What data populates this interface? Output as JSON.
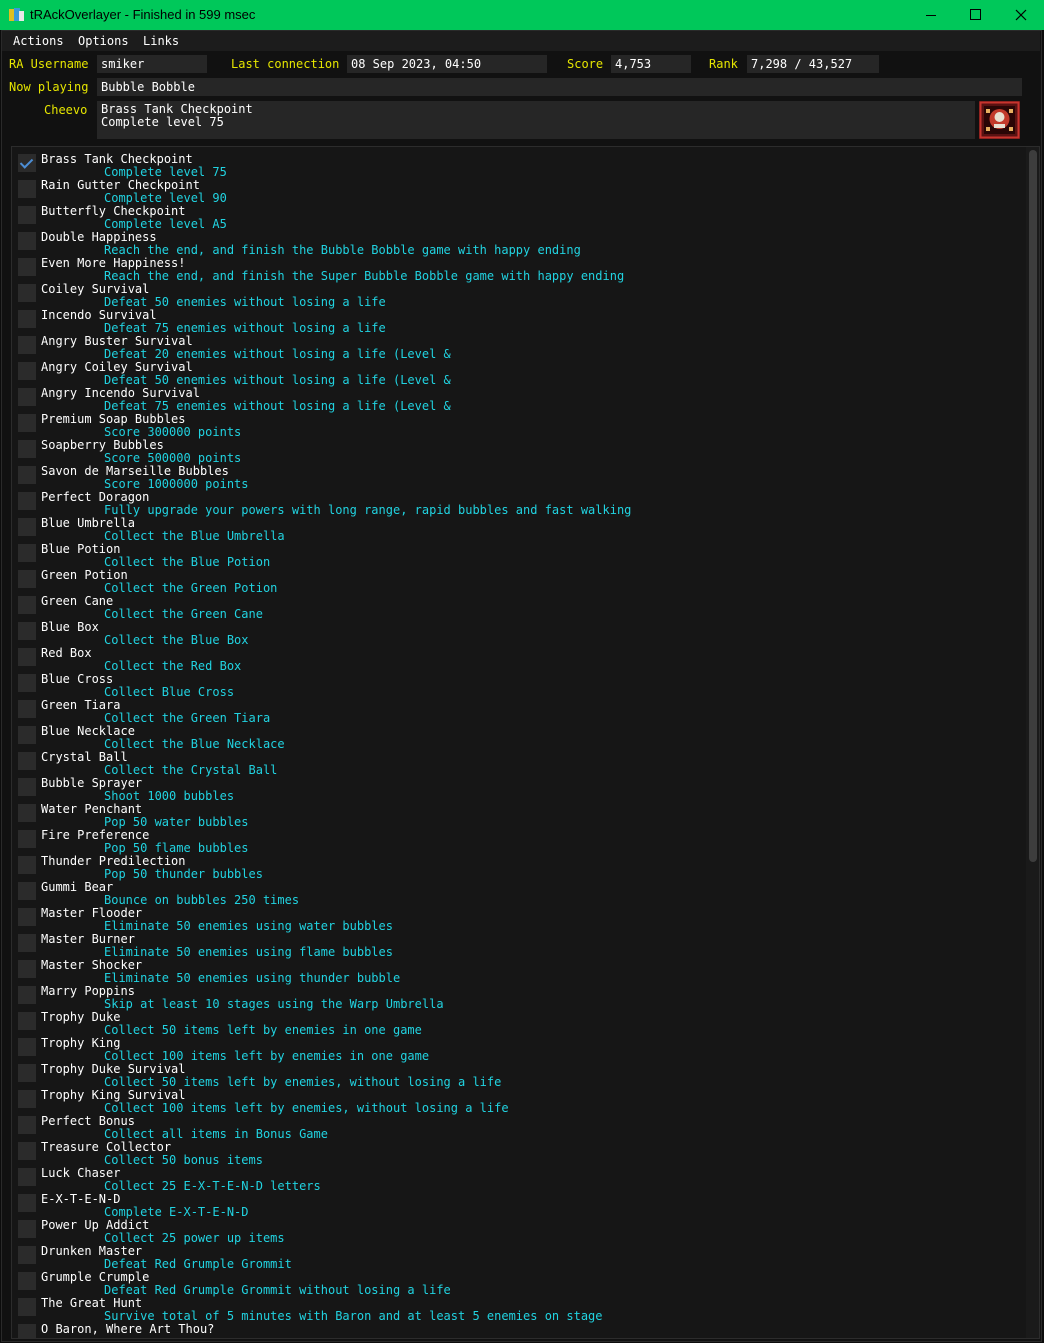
{
  "window": {
    "title": "tRAckOverlayer - Finished in 599 msec",
    "accent_color": "#00c85a",
    "icons": [
      "app-icon",
      "minimize-icon",
      "maximize-icon",
      "close-icon"
    ]
  },
  "menu": [
    "Actions",
    "Options",
    "Links"
  ],
  "header": {
    "username_label": "RA Username",
    "username": "smiker",
    "last_connection_label": "Last connection",
    "last_connection": "08 Sep 2023, 04:50",
    "score_label": "Score",
    "score": "4,753",
    "rank_label": "Rank",
    "rank": "7,298 / 43,527",
    "now_playing_label": "Now playing",
    "now_playing": "Bubble Bobble",
    "cheevo_label": "Cheevo",
    "cheevo_title": "Brass Tank Checkpoint",
    "cheevo_desc": "Complete level 75",
    "label_color": "#e6e600",
    "desc_color": "#21d3e1"
  },
  "achievements": [
    {
      "title": "Brass Tank Checkpoint",
      "desc": "Complete level 75",
      "checked": true
    },
    {
      "title": "Rain Gutter Checkpoint",
      "desc": "Complete level 90",
      "checked": false
    },
    {
      "title": "Butterfly Checkpoint",
      "desc": "Complete level A5",
      "checked": false
    },
    {
      "title": "Double Happiness",
      "desc": "Reach the end, and finish the Bubble Bobble game with happy ending",
      "checked": false
    },
    {
      "title": "Even More Happiness!",
      "desc": "Reach the end, and finish the Super Bubble Bobble game with happy ending",
      "checked": false
    },
    {
      "title": "Coiley Survival",
      "desc": "Defeat 50 enemies without losing a life",
      "checked": false
    },
    {
      "title": "Incendo Survival",
      "desc": "Defeat 75 enemies without losing a life",
      "checked": false
    },
    {
      "title": "Angry Buster Survival",
      "desc": "Defeat 20 enemies without losing a life (Level &",
      "checked": false
    },
    {
      "title": "Angry Coiley Survival",
      "desc": "Defeat 50 enemies without losing a life (Level &",
      "checked": false
    },
    {
      "title": "Angry Incendo Survival",
      "desc": "Defeat 75 enemies without losing a life (Level &",
      "checked": false
    },
    {
      "title": "Premium Soap Bubbles",
      "desc": "Score 300000 points",
      "checked": false
    },
    {
      "title": "Soapberry Bubbles",
      "desc": "Score 500000 points",
      "checked": false
    },
    {
      "title": "Savon de Marseille Bubbles",
      "desc": "Score 1000000 points",
      "checked": false
    },
    {
      "title": "Perfect Doragon",
      "desc": "Fully upgrade your powers with long range, rapid bubbles and fast walking",
      "checked": false
    },
    {
      "title": "Blue Umbrella",
      "desc": "Collect the Blue Umbrella",
      "checked": false
    },
    {
      "title": "Blue Potion",
      "desc": "Collect the Blue Potion",
      "checked": false
    },
    {
      "title": "Green Potion",
      "desc": "Collect the Green Potion",
      "checked": false
    },
    {
      "title": "Green Cane",
      "desc": "Collect the Green Cane",
      "checked": false
    },
    {
      "title": "Blue Box",
      "desc": "Collect the Blue Box",
      "checked": false
    },
    {
      "title": "Red Box",
      "desc": "Collect the Red Box",
      "checked": false
    },
    {
      "title": "Blue Cross",
      "desc": "Collect Blue Cross",
      "checked": false
    },
    {
      "title": "Green Tiara",
      "desc": "Collect the Green Tiara",
      "checked": false
    },
    {
      "title": "Blue Necklace",
      "desc": "Collect the Blue Necklace",
      "checked": false
    },
    {
      "title": "Crystal Ball",
      "desc": "Collect the Crystal Ball",
      "checked": false
    },
    {
      "title": "Bubble Sprayer",
      "desc": "Shoot 1000 bubbles",
      "checked": false
    },
    {
      "title": "Water Penchant",
      "desc": "Pop 50 water bubbles",
      "checked": false
    },
    {
      "title": "Fire Preference",
      "desc": "Pop 50 flame bubbles",
      "checked": false
    },
    {
      "title": "Thunder Predilection",
      "desc": "Pop 50 thunder bubbles",
      "checked": false
    },
    {
      "title": "Gummi Bear",
      "desc": "Bounce on bubbles 250 times",
      "checked": false
    },
    {
      "title": "Master Flooder",
      "desc": "Eliminate 50 enemies using water bubbles",
      "checked": false
    },
    {
      "title": "Master Burner",
      "desc": "Eliminate 50 enemies using flame bubbles",
      "checked": false
    },
    {
      "title": "Master Shocker",
      "desc": "Eliminate 50 enemies using thunder bubble",
      "checked": false
    },
    {
      "title": "Marry Poppins",
      "desc": "Skip at least 10 stages using the Warp Umbrella",
      "checked": false
    },
    {
      "title": "Trophy Duke",
      "desc": "Collect 50 items left by enemies in one game",
      "checked": false
    },
    {
      "title": "Trophy King",
      "desc": "Collect 100 items left by enemies in one game",
      "checked": false
    },
    {
      "title": "Trophy Duke Survival",
      "desc": "Collect 50 items left by enemies, without losing a life",
      "checked": false
    },
    {
      "title": "Trophy King Survival",
      "desc": "Collect 100 items left by enemies, without losing a life",
      "checked": false
    },
    {
      "title": "Perfect Bonus",
      "desc": "Collect all items in Bonus Game",
      "checked": false
    },
    {
      "title": "Treasure Collector",
      "desc": "Collect 50 bonus items",
      "checked": false
    },
    {
      "title": "Luck Chaser",
      "desc": "Collect 25 E-X-T-E-N-D letters",
      "checked": false
    },
    {
      "title": "E-X-T-E-N-D",
      "desc": "Complete E-X-T-E-N-D",
      "checked": false
    },
    {
      "title": "Power Up Addict",
      "desc": "Collect 25 power up items",
      "checked": false
    },
    {
      "title": "Drunken Master",
      "desc": "Defeat Red Grumple Grommit",
      "checked": false
    },
    {
      "title": "Grumple Crumple",
      "desc": "Defeat Red Grumple Grommit without losing a life",
      "checked": false
    },
    {
      "title": "The Great Hunt",
      "desc": "Survive total of 5 minutes with Baron and at least 5 enemies on stage",
      "checked": false
    },
    {
      "title": "O Baron, Where Art Thou?",
      "desc": "",
      "checked": false
    }
  ]
}
